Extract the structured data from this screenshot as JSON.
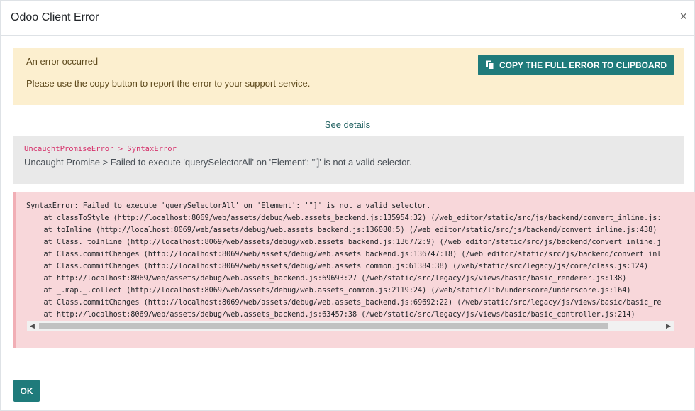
{
  "dialog": {
    "title": "Odoo Client Error",
    "close_glyph": "×"
  },
  "alert": {
    "title": "An error occurred",
    "text": "Please use the copy button to report the error to your support service.",
    "copy_button_label": "COPY THE FULL ERROR TO CLIPBOARD",
    "copy_icon": "clipboard-icon"
  },
  "details_link": "See details",
  "summary": {
    "code": "UncaughtPromiseError > SyntaxError",
    "message": "Uncaught Promise > Failed to execute 'querySelectorAll' on 'Element': '\"]' is not a valid selector."
  },
  "trace": {
    "text": "SyntaxError: Failed to execute 'querySelectorAll' on 'Element': '\"]' is not a valid selector.\n    at classToStyle (http://localhost:8069/web/assets/debug/web.assets_backend.js:135954:32) (/web_editor/static/src/js/backend/convert_inline.js:\n    at toInline (http://localhost:8069/web/assets/debug/web.assets_backend.js:136080:5) (/web_editor/static/src/js/backend/convert_inline.js:438)\n    at Class._toInline (http://localhost:8069/web/assets/debug/web.assets_backend.js:136772:9) (/web_editor/static/src/js/backend/convert_inline.j\n    at Class.commitChanges (http://localhost:8069/web/assets/debug/web.assets_backend.js:136747:18) (/web_editor/static/src/js/backend/convert_inl\n    at Class.commitChanges (http://localhost:8069/web/assets/debug/web.assets_common.js:61384:38) (/web/static/src/legacy/js/core/class.js:124)\n    at http://localhost:8069/web/assets/debug/web.assets_backend.js:69693:27 (/web/static/src/legacy/js/views/basic/basic_renderer.js:138)\n    at _.map._.collect (http://localhost:8069/web/assets/debug/web.assets_common.js:2119:24) (/web/static/lib/underscore/underscore.js:164)\n    at Class.commitChanges (http://localhost:8069/web/assets/debug/web.assets_backend.js:69692:22) (/web/static/src/legacy/js/views/basic/basic_re\n    at http://localhost:8069/web/assets/debug/web.assets_backend.js:63457:38 (/web/static/src/legacy/js/views/basic/basic_controller.js:214)"
  },
  "scrollbar": {
    "left_arrow": "◀",
    "right_arrow": "▶"
  },
  "footer": {
    "ok_label": "OK"
  },
  "colors": {
    "primary": "#1f7b7b",
    "warning_bg": "#fcefcf",
    "danger_bg": "#f8d7da",
    "summary_bg": "#e9e9e9"
  }
}
